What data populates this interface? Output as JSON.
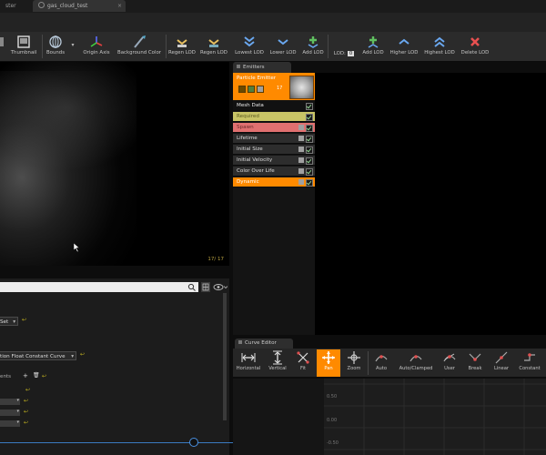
{
  "window": {
    "tabs": [
      {
        "label": "ster"
      },
      {
        "label": "gas_cloud_test"
      }
    ]
  },
  "toolbar": {
    "items": [
      {
        "label": "Thumbnail",
        "icon": "thumbnail-icon"
      },
      {
        "label": "Bounds",
        "icon": "bounds-icon"
      },
      {
        "label": "Origin Axis",
        "icon": "origin-axis-icon"
      },
      {
        "label": "Background Color",
        "icon": "background-color-icon"
      },
      {
        "label": "Regen LOD",
        "icon": "regen-lod-icon"
      },
      {
        "label": "Regen LOD",
        "icon": "regen-lod-duplicate-icon"
      },
      {
        "label": "Lowest LOD",
        "icon": "lowest-lod-icon"
      },
      {
        "label": "Lower LOD",
        "icon": "lower-lod-icon"
      },
      {
        "label": "Add LOD",
        "icon": "add-lod-icon"
      },
      {
        "label": "LOD:",
        "icon": "lod-field"
      },
      {
        "label": "Add LOD",
        "icon": "add-lod-after-icon"
      },
      {
        "label": "Higher LOD",
        "icon": "higher-lod-icon"
      },
      {
        "label": "Highest LOD",
        "icon": "highest-lod-icon"
      },
      {
        "label": "Delete LOD",
        "icon": "delete-lod-icon"
      }
    ],
    "lod_value": "0"
  },
  "viewport": {
    "counter": "17/ 17"
  },
  "emitters": {
    "tab_label": "Emitters",
    "emitter_name": "Particle Emitter",
    "emitter_count": "17",
    "modules": [
      {
        "label": "Mesh Data",
        "style": "dark"
      },
      {
        "label": "Required",
        "style": "yellow"
      },
      {
        "label": "Spawn",
        "style": "red"
      },
      {
        "label": "Lifetime",
        "style": "normal"
      },
      {
        "label": "Initial Size",
        "style": "normal"
      },
      {
        "label": "Initial Velocity",
        "style": "normal"
      },
      {
        "label": "Color Over Life",
        "style": "normal"
      },
      {
        "label": "Dynamic",
        "style": "orange"
      }
    ]
  },
  "details": {
    "dropdown1": "Set",
    "dropdown2": "tion Float Constant Curve",
    "elements_label": "ents"
  },
  "curve_editor": {
    "tab_label": "Curve Editor",
    "buttons": [
      {
        "label": "Horizontal",
        "icon": "fit-horizontal-icon"
      },
      {
        "label": "Vertical",
        "icon": "fit-vertical-icon"
      },
      {
        "label": "Fit",
        "icon": "fit-icon"
      },
      {
        "label": "Pan",
        "icon": "pan-icon",
        "active": true
      },
      {
        "label": "Zoom",
        "icon": "zoom-icon"
      },
      {
        "label": "Auto",
        "icon": "auto-tangent-icon"
      },
      {
        "label": "Auto/Clamped",
        "icon": "auto-clamped-icon"
      },
      {
        "label": "User",
        "icon": "user-tangent-icon"
      },
      {
        "label": "Break",
        "icon": "break-tangent-icon"
      },
      {
        "label": "Linear",
        "icon": "linear-icon"
      },
      {
        "label": "Constant",
        "icon": "constant-icon"
      }
    ],
    "grid_labels": [
      "0.50",
      "0.00",
      "-0.50"
    ]
  },
  "colors": {
    "accent_orange": "#ff8a00",
    "module_yellow": "#c8c466",
    "module_red": "#e07070",
    "timeline_blue": "#3a7ac0"
  }
}
